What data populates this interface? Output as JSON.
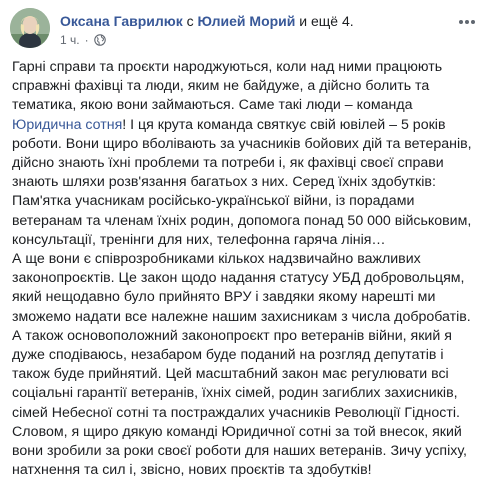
{
  "post": {
    "author": "Оксана Гаврилюк",
    "with_prefix": "с",
    "tagged_person": "Юлией Морий",
    "and_more": "и ещё 4.",
    "time": "1 ч.",
    "time_separator": "·",
    "privacy_icon": "globe-icon",
    "more_icon": "more-options-icon",
    "paragraph1": {
      "part1": "Гарні справи та проєкти народжуються, коли над ними працюють справжні фахівці та люди, яким не байдуже, а дійсно болить та тематика, якою вони займаються. Саме такі люди – команда ",
      "link": "Юридична сотня",
      "part2": "! І ця крута команда святкує свій ювілей – 5 років роботи. Вони щиро вболівають за учасників бойових дій та ветеранів, дійсно знають їхні проблеми та потреби і, як фахівці своєї справи знають шляхи розв'язання багатьох з них. Серед їхніх здобутків: Пам'ятка учасникам російсько-української війни, із порадами ветеранам та членам їхніх родин, допомога понад 50 000 військовим, консультації, тренінги для них, телефонна гаряча лінія…"
    },
    "paragraph2": "А ще вони є співрозробниками кількох надзвичайно важливих законопроєктів. Це закон щодо надання статусу УБД добровольцям, який нещодавно було прийнято ВРУ і завдяки якому нарешті ми зможемо надати все належне нашим захисникам з числа добробатів. А також основоположний законопроєкт про ветеранів війни, який я дуже сподіваюсь, незабаром буде поданий на розгляд депутатів і також буде прийнятий. Цей масштабний закон має регулювати всі соціальні гарантії ветеранів, їхніх сімей, родин загиблих захисників, сімей Небесної сотні та постраждалих учасників Революції Гідності.",
    "paragraph3": "Словом, я щиро дякую команді Юридичної сотні за той внесок, який вони зробили за роки своєї роботи для наших ветеранів. Зичу успіху, натхнення та сил і, звісно, нових проєктів та здобутків!"
  },
  "colors": {
    "link": "#385898",
    "text": "#1c1e21",
    "meta": "#616770",
    "background": "#ffffff"
  }
}
